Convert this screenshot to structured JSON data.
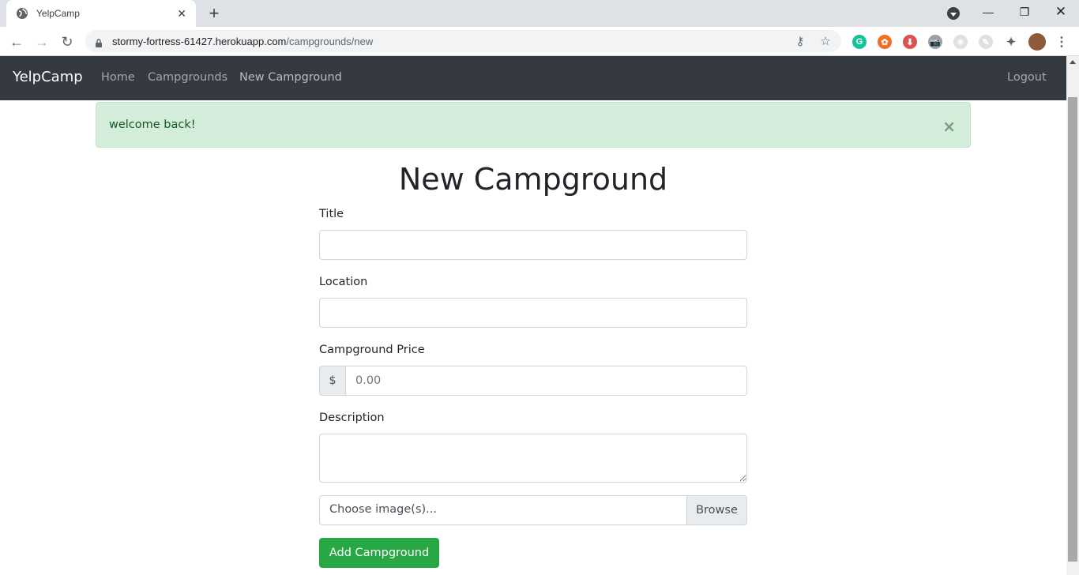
{
  "browser": {
    "tab_title": "YelpCamp",
    "url_host": "stormy-fortress-61427.herokuapp.com",
    "url_path": "/campgrounds/new",
    "extensions": [
      {
        "name": "grammarly-icon",
        "glyph": "G",
        "color": "#15c39a"
      },
      {
        "name": "lifebuoy-icon",
        "glyph": "✿",
        "color": "#f26d21"
      },
      {
        "name": "download-icon",
        "glyph": "⬇",
        "color": "#d9534f"
      },
      {
        "name": "camera-icon",
        "glyph": "📷",
        "color": "#9aa0a6"
      },
      {
        "name": "react-icon",
        "glyph": "⚛",
        "color": "#e0e0e0"
      },
      {
        "name": "note-icon",
        "glyph": "✎",
        "color": "#e0e0e0"
      }
    ]
  },
  "navbar": {
    "brand": "YelpCamp",
    "links": [
      "Home",
      "Campgrounds",
      "New Campground"
    ],
    "logout": "Logout"
  },
  "alert": {
    "message": "welcome back!",
    "close_glyph": "×"
  },
  "page": {
    "heading": "New Campground"
  },
  "form": {
    "title_label": "Title",
    "title_value": "",
    "location_label": "Location",
    "location_value": "",
    "price_label": "Campground Price",
    "price_prefix": "$",
    "price_placeholder": "0.00",
    "description_label": "Description",
    "description_value": "",
    "file_label": "Choose image(s)...",
    "browse_label": "Browse",
    "submit_label": "Add Campground"
  }
}
